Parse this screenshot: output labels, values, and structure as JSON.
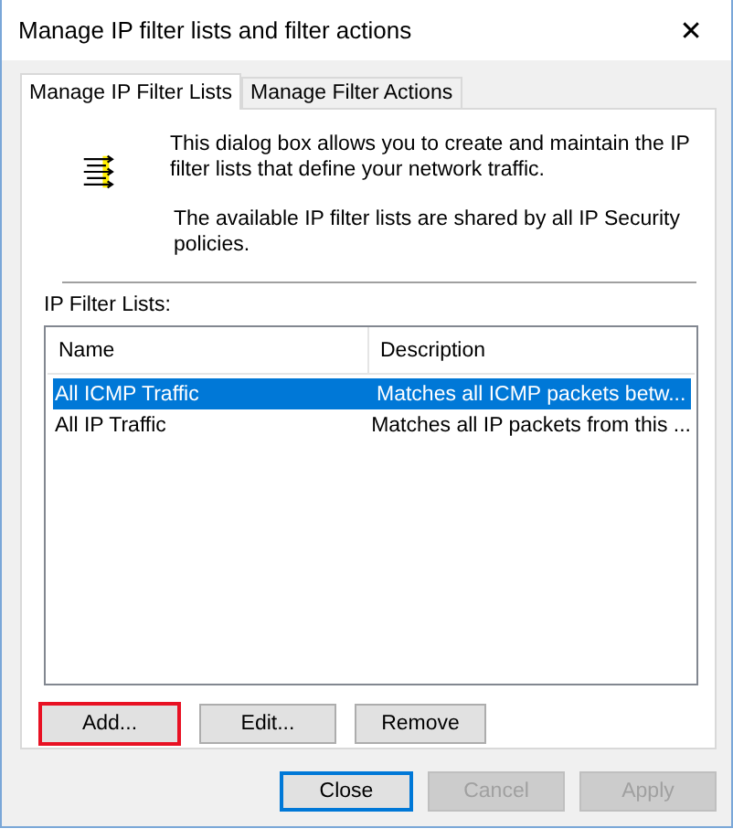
{
  "window": {
    "title": "Manage IP filter lists and filter actions",
    "close": "✕"
  },
  "tabs": [
    {
      "label": "Manage IP Filter Lists",
      "selected": true
    },
    {
      "label": "Manage Filter Actions",
      "selected": false
    }
  ],
  "intro": [
    "This dialog box allows you to create and maintain the IP filter lists that define your network traffic.",
    "The available IP filter lists are shared by all IP Security policies."
  ],
  "list_label": "IP Filter Lists:",
  "table": {
    "columns": [
      "Name",
      "Description"
    ],
    "rows": [
      {
        "cells": [
          "All ICMP Traffic",
          "Matches all ICMP packets betw..."
        ],
        "selected": true
      },
      {
        "cells": [
          "All IP Traffic",
          "Matches all IP packets from this ..."
        ],
        "selected": false
      }
    ]
  },
  "list_buttons": [
    {
      "label": "Add...",
      "highlighted": true
    },
    {
      "label": "Edit...",
      "highlighted": false
    },
    {
      "label": "Remove",
      "highlighted": false
    }
  ],
  "buttons": [
    {
      "label": "Close",
      "default": true,
      "disabled": false
    },
    {
      "label": "Cancel",
      "default": false,
      "disabled": true
    },
    {
      "label": "Apply",
      "default": false,
      "disabled": true
    }
  ]
}
